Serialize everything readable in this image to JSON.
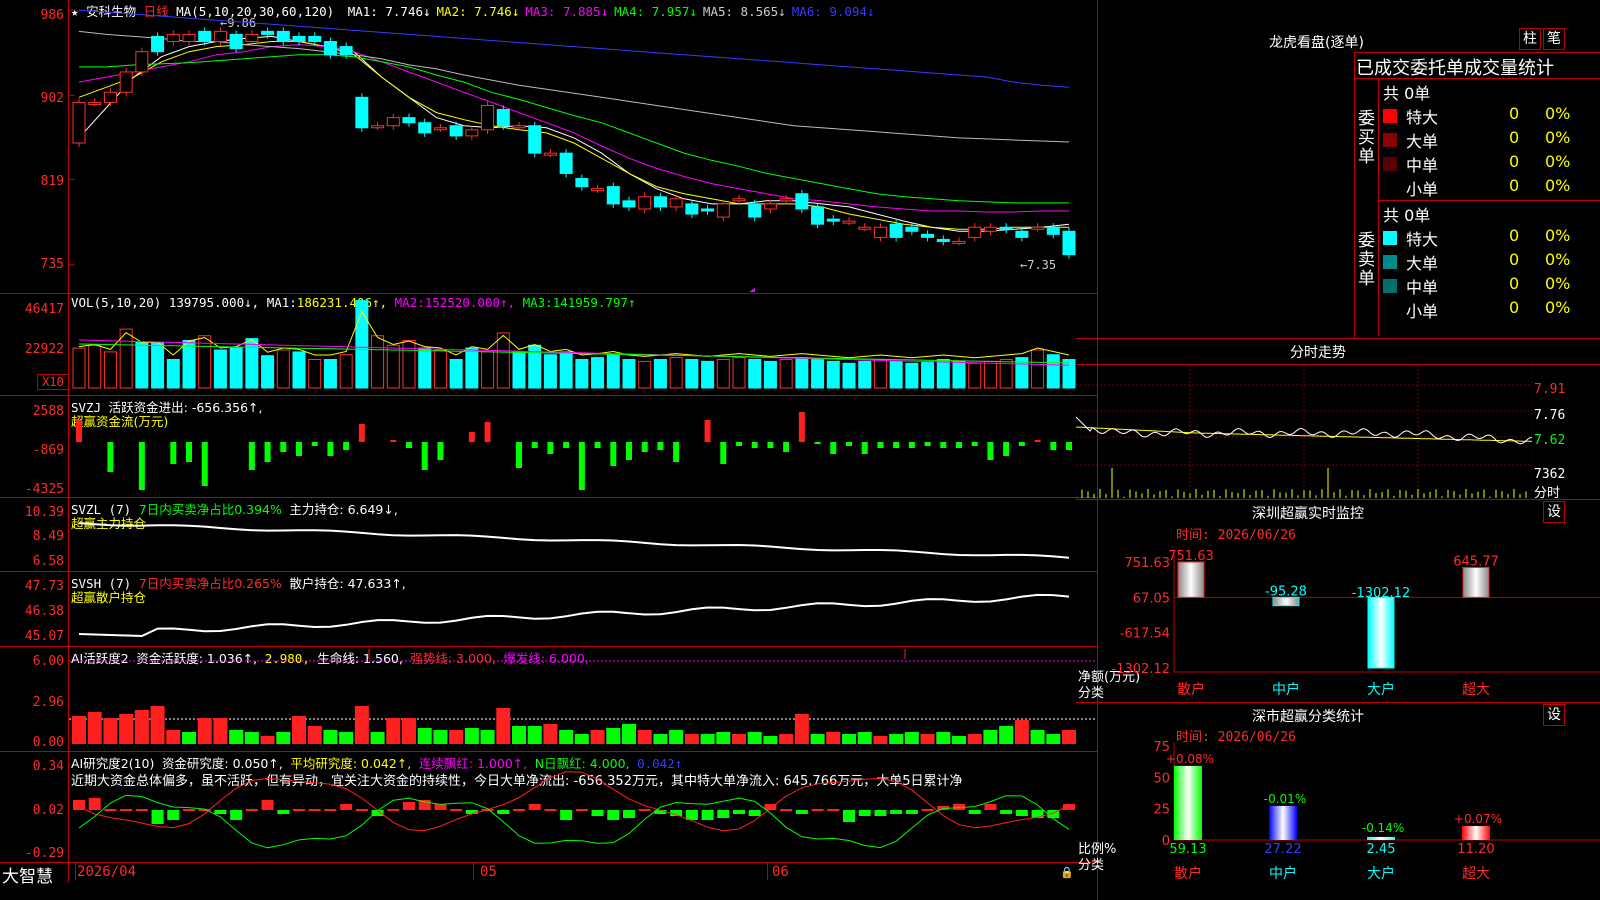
{
  "stock": {
    "star": "★",
    "name": "安科生物",
    "period": "日线",
    "ma_prefix": "MA(5,10,20,30,60,120)",
    "ma": [
      {
        "label": "MA1:",
        "value": "7.746↓",
        "color": "#ffffff"
      },
      {
        "label": "MA2:",
        "value": "7.746↓",
        "color": "#ffff00"
      },
      {
        "label": "MA3:",
        "value": "7.885↓",
        "color": "#ff00ff"
      },
      {
        "label": "MA4:",
        "value": "7.957↓",
        "color": "#00ff00"
      },
      {
        "label": "MA5:",
        "value": "8.565↓",
        "color": "#cccccc"
      },
      {
        "label": "MA6:",
        "value": "9.094↓",
        "color": "#3a3aff"
      }
    ],
    "high_marker": "9.86",
    "low_marker": "←7.35",
    "y_labels": [
      "986",
      "902",
      "819",
      "735"
    ]
  },
  "vol": {
    "title": "VOL(5,10,20)",
    "value": "139795.000↓,",
    "ma1_label": "MA1:",
    "ma1": "186231.406↑,",
    "ma2_label": "MA2:",
    "ma2": "152520.000↑,",
    "ma3_label": "MA3:",
    "ma3": "141959.797↑",
    "y_labels": [
      "46417",
      "22922"
    ],
    "unit": "X10"
  },
  "svzj": {
    "title": "SVZJ",
    "text": "活跃资金进出: -656.356↑,",
    "sub": "超赢资金流(万元)",
    "y_labels": [
      "2588",
      "-869",
      "-4325"
    ]
  },
  "svzl": {
    "title": "SVZL (7)",
    "text1": "7日内买卖净占比0.394%",
    "text2": "主力持仓: 6.649↓,",
    "sub": "超赢主力持仓",
    "y_labels": [
      "10.39",
      "8.49",
      "6.58"
    ]
  },
  "svsh": {
    "title": "SVSH (7)",
    "text1": "7日内买卖净占比0.265%",
    "text2": "散户持仓: 47.633↑,",
    "sub": "超赢散户持仓",
    "y_labels": [
      "47.73",
      "46.38",
      "45.07"
    ]
  },
  "ai_active": {
    "title": "AI活跃度2",
    "text": "资金活跃度: 1.036↑,",
    "v2": "2.980,",
    "life": "生命线: 1.560,",
    "strong": "强势线: 3.000,",
    "burst": "爆发线: 6.000,",
    "y_labels": [
      "6.00",
      "2.96",
      "0.00"
    ]
  },
  "ai_research": {
    "title": "AI研究度2(10)",
    "text": "资金研究度: 0.050↑,",
    "avg": "平均研究度: 0.042↑,",
    "cont": "连续飘红: 1.000↑,",
    "nday": "N日飘红: 4.000,",
    "last": "0.042↑",
    "comment": "近期大资金总体偏多，虽不活跃，但有异动，宜关注大资金的持续性，今日大单净流出: -656.352万元，其中特大单净流入: 645.766万元，大单5日累计净",
    "y_labels": [
      "0.34",
      "0.02",
      "-0.29"
    ]
  },
  "footer": {
    "brand": "大智慧",
    "date": "2026/04",
    "m05": "05",
    "m06": "06"
  },
  "right": {
    "lhb_title": "龙虎看盘(逐单)",
    "btn_bar": "柱",
    "btn_pen": "笔",
    "order_header": "已成交委托单成交量统计",
    "buy_side": "委买单",
    "sell_side": "委卖单",
    "buy_total": "共 0单",
    "sell_total": "共 0单",
    "buy_rows": [
      {
        "label": "特大",
        "count": "0",
        "pct": "0%",
        "color": "#ff0000"
      },
      {
        "label": "大单",
        "count": "0",
        "pct": "0%",
        "color": "#8b0000"
      },
      {
        "label": "中单",
        "count": "0",
        "pct": "0%",
        "color": "#5a0000"
      },
      {
        "label": "小单",
        "count": "0",
        "pct": "0%",
        "color": ""
      }
    ],
    "sell_rows": [
      {
        "label": "特大",
        "count": "0",
        "pct": "0%",
        "color": "#00ffff"
      },
      {
        "label": "大单",
        "count": "0",
        "pct": "0%",
        "color": "#008b8b"
      },
      {
        "label": "中单",
        "count": "0",
        "pct": "0%",
        "color": "#006f6f"
      },
      {
        "label": "小单",
        "count": "0",
        "pct": "0%",
        "color": ""
      }
    ],
    "intraday_title": "分时走势",
    "intraday_y": [
      "7.91",
      "7.76",
      "7.62",
      "7362",
      "分时"
    ],
    "sz_title": "深圳超赢实时监控",
    "sz_btn": "设",
    "sz_time": "时间: 2026/06/26",
    "sz_y": [
      "751.63",
      "67.05",
      "-617.54",
      "-1302.12"
    ],
    "sz_ylabel": "净额(万元)",
    "sz_xlabel": "分类",
    "sz_bars": [
      {
        "cat": "散户",
        "label": "751.63",
        "value": 751.63
      },
      {
        "cat": "中户",
        "label": "-95.28",
        "value": -95.28
      },
      {
        "cat": "大户",
        "label": "-1302.12",
        "value": -1302.12
      },
      {
        "cat": "超大",
        "label": "645.77",
        "value": 645.77
      }
    ],
    "cls_title": "深市超赢分类统计",
    "cls_btn": "设",
    "cls_time": "时间: 2026/06/26",
    "cls_y": [
      "75",
      "50",
      "25",
      "0"
    ],
    "cls_ylabel": "比例%",
    "cls_xlabel": "分类",
    "cls_bars": [
      {
        "cat": "散户",
        "value": 59.13,
        "label": "59.13",
        "chg": "+0.08%",
        "color": "#00ff00"
      },
      {
        "cat": "中户",
        "value": 27.22,
        "label": "27.22",
        "chg": "-0.01%",
        "color": "#0000ff"
      },
      {
        "cat": "大户",
        "value": 2.45,
        "label": "2.45",
        "chg": "-0.14%",
        "color": "#00ffff"
      },
      {
        "cat": "超大",
        "value": 11.2,
        "label": "11.20",
        "chg": "+0.07%",
        "color": "#ff0000"
      }
    ]
  },
  "chart_data": {
    "type": "candlestick",
    "title": "安科生物 日线",
    "ylim": [
      7.2,
      9.9
    ],
    "candles": [
      [
        8.55,
        8.95
      ],
      [
        8.95,
        8.95
      ],
      [
        8.95,
        9.05
      ],
      [
        9.05,
        9.25
      ],
      [
        9.25,
        9.45
      ],
      [
        9.6,
        9.45
      ],
      [
        9.55,
        9.62
      ],
      [
        9.55,
        9.62
      ],
      [
        9.65,
        9.55
      ],
      [
        9.55,
        9.65
      ],
      [
        9.62,
        9.48
      ],
      [
        9.55,
        9.62
      ],
      [
        9.65,
        9.62
      ],
      [
        9.65,
        9.55
      ],
      [
        9.6,
        9.55
      ],
      [
        9.6,
        9.55
      ],
      [
        9.55,
        9.42
      ],
      [
        9.5,
        9.42
      ],
      [
        9.0,
        8.7
      ],
      [
        8.72,
        8.72
      ],
      [
        8.72,
        8.8
      ],
      [
        8.8,
        8.75
      ],
      [
        8.75,
        8.65
      ],
      [
        8.7,
        8.7
      ],
      [
        8.72,
        8.62
      ],
      [
        8.62,
        8.68
      ],
      [
        8.68,
        8.92
      ],
      [
        8.88,
        8.72
      ],
      [
        8.72,
        8.72
      ],
      [
        8.72,
        8.45
      ],
      [
        8.45,
        8.45
      ],
      [
        8.45,
        8.25
      ],
      [
        8.2,
        8.12
      ],
      [
        8.1,
        8.1
      ],
      [
        8.12,
        7.95
      ],
      [
        7.98,
        7.92
      ],
      [
        7.9,
        8.02
      ],
      [
        8.02,
        7.92
      ],
      [
        7.92,
        8.0
      ],
      [
        7.95,
        7.85
      ],
      [
        7.9,
        7.88
      ],
      [
        7.82,
        7.95
      ],
      [
        8.0,
        8.0
      ],
      [
        7.95,
        7.82
      ],
      [
        7.9,
        7.95
      ],
      [
        8.0,
        8.0
      ],
      [
        8.05,
        7.9
      ],
      [
        7.92,
        7.75
      ],
      [
        7.8,
        7.78
      ],
      [
        7.78,
        7.78
      ],
      [
        7.72,
        7.72
      ],
      [
        7.62,
        7.72
      ],
      [
        7.75,
        7.62
      ],
      [
        7.72,
        7.68
      ],
      [
        7.65,
        7.62
      ],
      [
        7.6,
        7.58
      ],
      [
        7.58,
        7.58
      ],
      [
        7.62,
        7.72
      ],
      [
        7.68,
        7.72
      ],
      [
        7.72,
        7.7
      ],
      [
        7.68,
        7.62
      ],
      [
        7.72,
        7.72
      ],
      [
        7.72,
        7.65
      ],
      [
        7.68,
        7.45
      ]
    ],
    "ma_series": {
      "MA5": [
        8.6,
        8.9,
        9.2,
        9.4,
        9.5,
        9.55,
        9.58,
        9.6,
        9.55,
        9.5,
        9.45,
        9.2,
        9.0,
        8.8,
        8.72,
        8.7,
        8.72,
        8.7,
        8.6,
        8.45,
        8.25,
        8.1,
        8.0,
        7.95,
        7.95,
        7.98,
        7.98,
        7.95,
        7.92,
        7.85,
        7.78,
        7.72,
        7.68,
        7.68,
        7.7,
        7.72,
        7.75
      ],
      "MA10": [
        9.0,
        9.1,
        9.2,
        9.35,
        9.45,
        9.5,
        9.52,
        9.55,
        9.55,
        9.5,
        9.42,
        9.2,
        9.0,
        8.85,
        8.78,
        8.72,
        8.68,
        8.65,
        8.55,
        8.4,
        8.25,
        8.12,
        8.05,
        8.0,
        7.95,
        7.95,
        7.95,
        7.92,
        7.85,
        7.8,
        7.75,
        7.72,
        7.7,
        7.7,
        7.72,
        7.72,
        7.72
      ],
      "MA20": [
        9.15,
        9.2,
        9.25,
        9.3,
        9.35,
        9.42,
        9.45,
        9.5,
        9.52,
        9.5,
        9.45,
        9.35,
        9.25,
        9.15,
        9.05,
        8.95,
        8.85,
        8.75,
        8.65,
        8.52,
        8.4,
        8.3,
        8.22,
        8.15,
        8.1,
        8.05,
        8.0,
        7.98,
        7.95,
        7.92,
        7.9,
        7.88,
        7.88,
        7.87,
        7.87,
        7.88,
        7.88
      ],
      "MA30": [
        9.3,
        9.3,
        9.32,
        9.33,
        9.34,
        9.36,
        9.38,
        9.4,
        9.42,
        9.42,
        9.4,
        9.35,
        9.3,
        9.22,
        9.15,
        9.05,
        8.98,
        8.9,
        8.82,
        8.75,
        8.65,
        8.55,
        8.45,
        8.38,
        8.32,
        8.25,
        8.2,
        8.15,
        8.1,
        8.05,
        8.02,
        8.0,
        7.98,
        7.97,
        7.96,
        7.96,
        7.96
      ],
      "MA60": [
        9.65,
        9.62,
        9.6,
        9.58,
        9.55,
        9.55,
        9.52,
        9.5,
        9.48,
        9.45,
        9.42,
        9.38,
        9.32,
        9.28,
        9.22,
        9.17,
        9.12,
        9.08,
        9.04,
        9.0,
        8.96,
        8.92,
        8.88,
        8.84,
        8.8,
        8.76,
        8.72,
        8.7,
        8.68,
        8.66,
        8.64,
        8.62,
        8.6,
        8.59,
        8.58,
        8.57,
        8.56
      ],
      "MA120": [
        9.86,
        9.84,
        9.82,
        9.8,
        9.78,
        9.76,
        9.74,
        9.72,
        9.7,
        9.68,
        9.66,
        9.64,
        9.62,
        9.6,
        9.58,
        9.56,
        9.54,
        9.52,
        9.5,
        9.48,
        9.46,
        9.44,
        9.42,
        9.4,
        9.38,
        9.36,
        9.34,
        9.32,
        9.3,
        9.28,
        9.26,
        9.24,
        9.22,
        9.2,
        9.15,
        9.12,
        9.1
      ]
    }
  }
}
